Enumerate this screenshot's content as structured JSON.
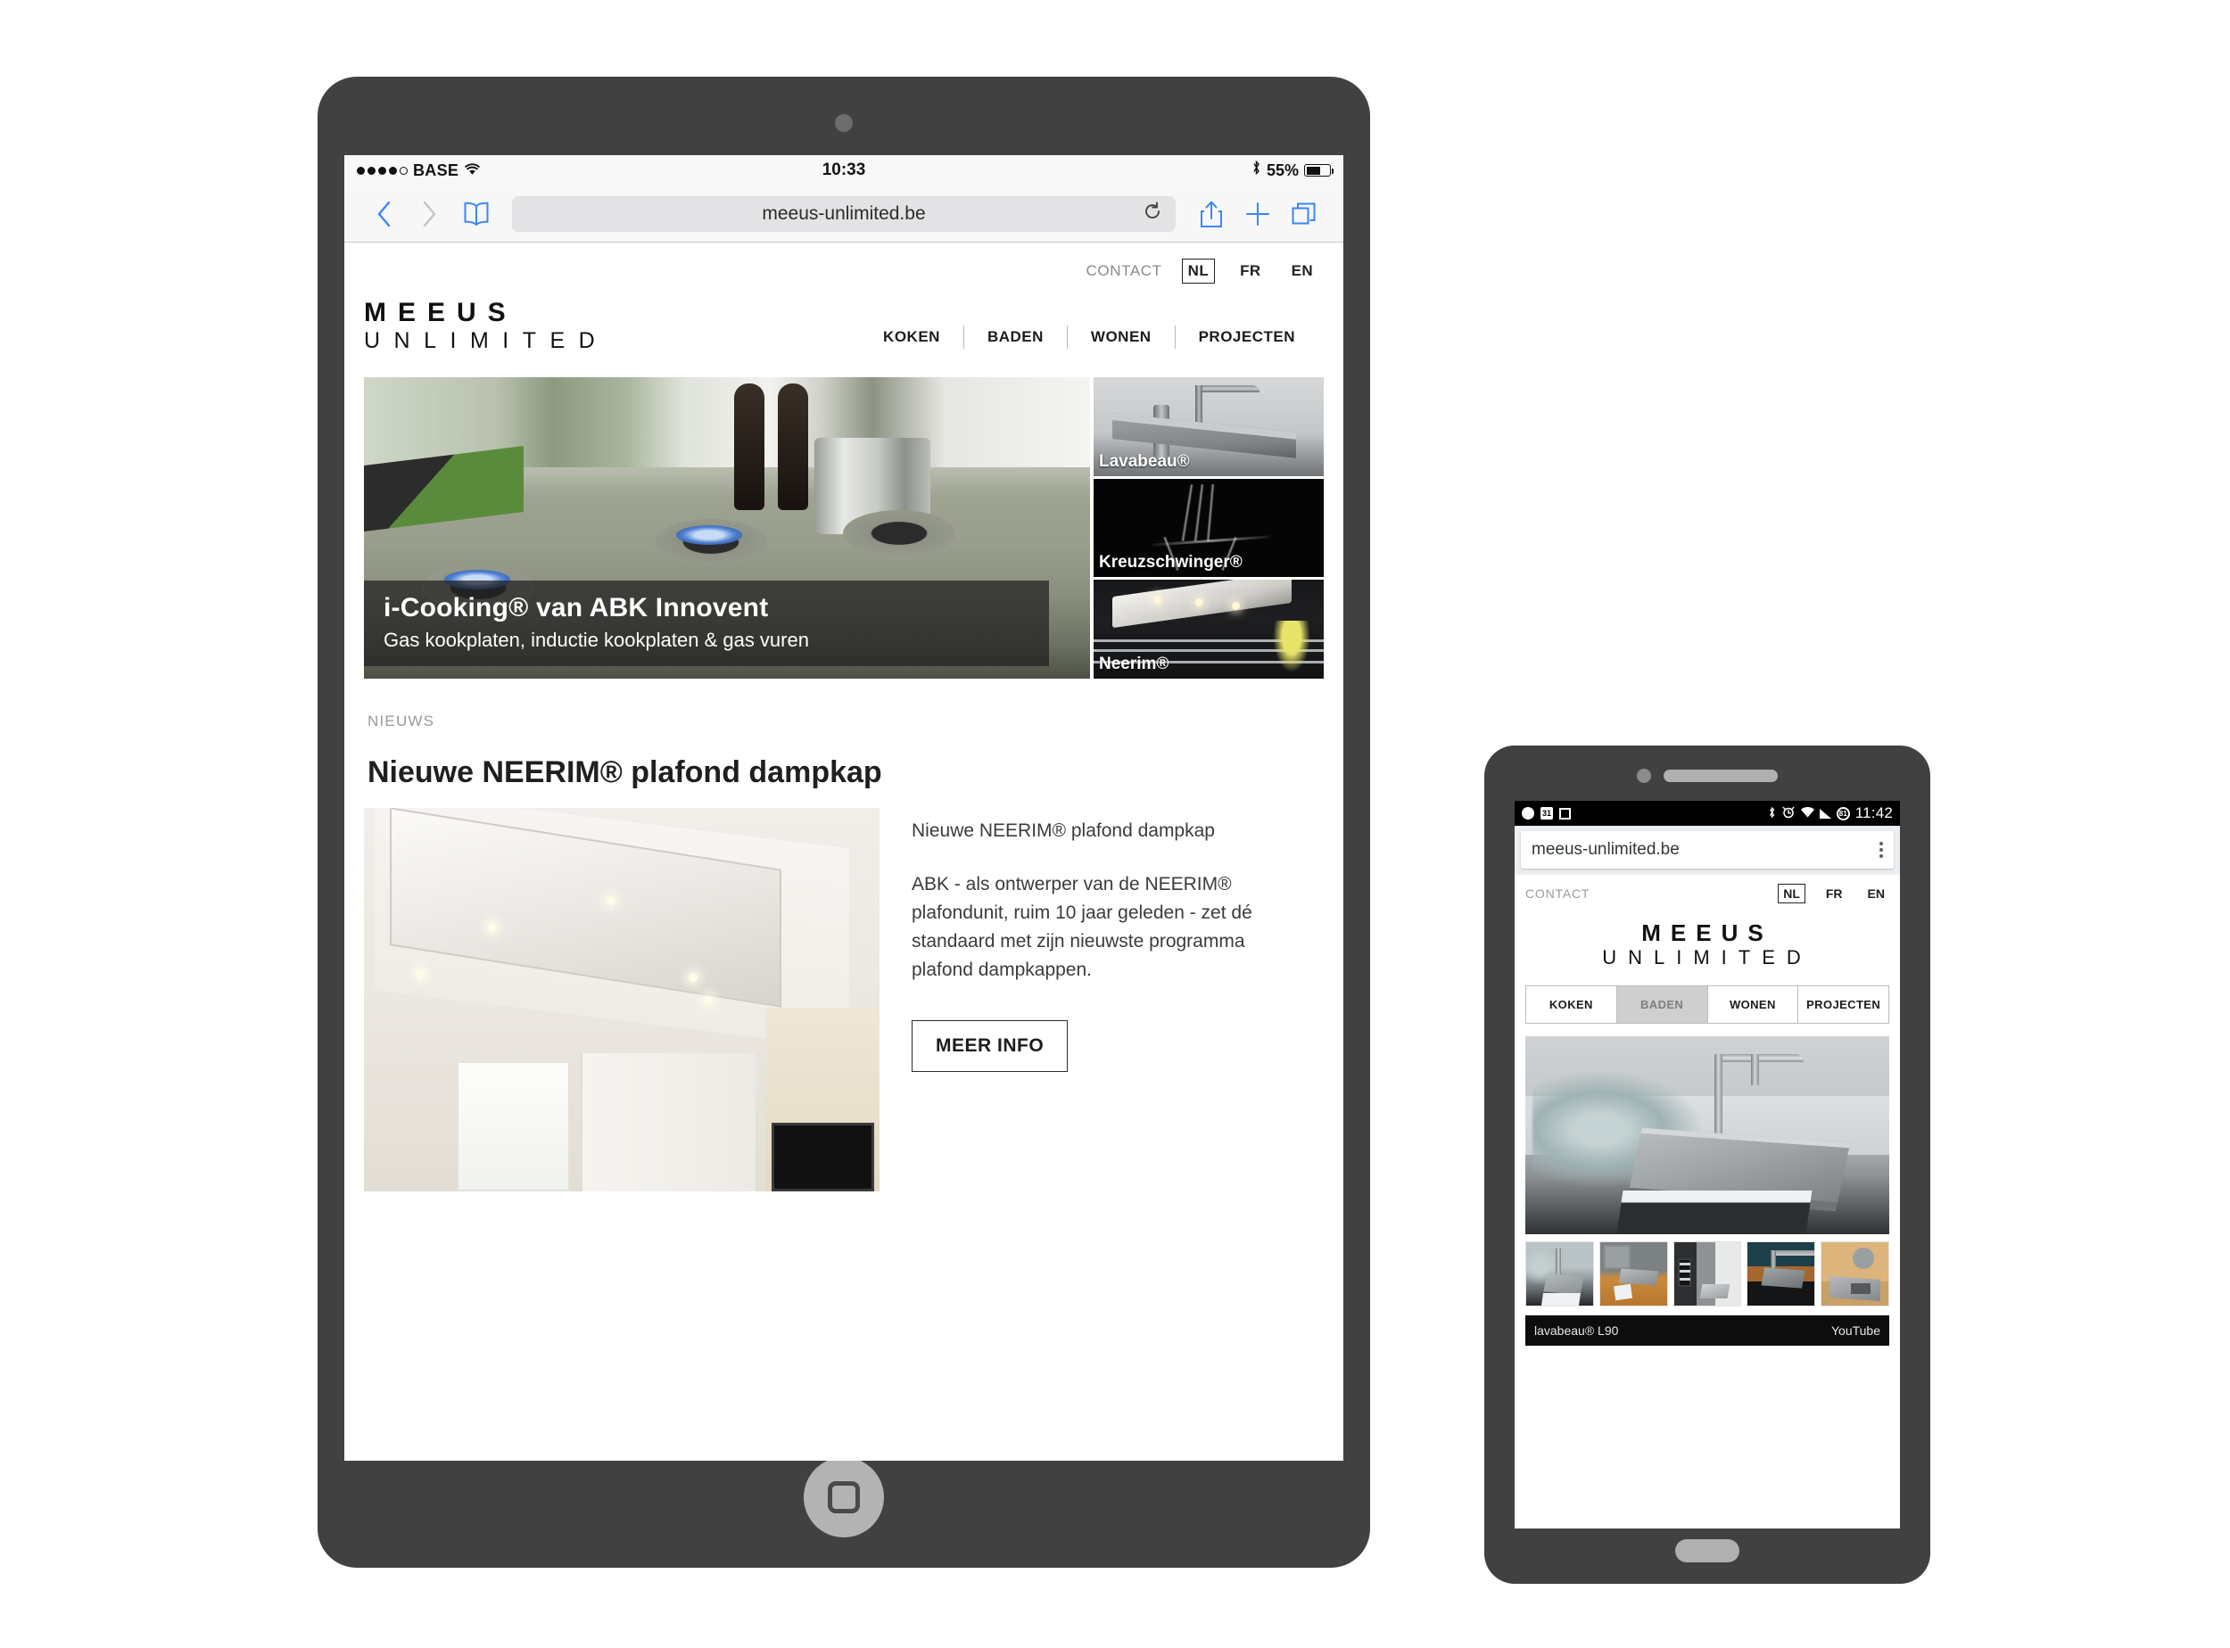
{
  "tablet": {
    "status_bar": {
      "carrier": "BASE",
      "wifi_icon": "wifi-icon",
      "time": "10:33",
      "bluetooth_icon": "bluetooth-icon",
      "battery_percent": "55%",
      "battery_icon": "battery-icon"
    },
    "browser": {
      "back_icon": "back-chevron-icon",
      "forward_icon": "forward-chevron-icon",
      "bookmarks_icon": "book-icon",
      "url": "meeus-unlimited.be",
      "reload_icon": "reload-icon",
      "share_icon": "share-icon",
      "new_tab_icon": "plus-icon",
      "tabs_icon": "tabs-icon"
    },
    "site": {
      "contact_label": "CONTACT",
      "languages": [
        {
          "code": "NL",
          "active": true
        },
        {
          "code": "FR",
          "active": false
        },
        {
          "code": "EN",
          "active": false
        }
      ],
      "logo_line1": "MEEUS",
      "logo_line2": "UNLIMITED",
      "nav": [
        "KOKEN",
        "BADEN",
        "WONEN",
        "PROJECTEN"
      ],
      "hero": {
        "title": "i-Cooking® van ABK Innovent",
        "subtitle": "Gas kookplaten, inductie kookplaten & gas vuren",
        "tiles": [
          {
            "label": "Lavabeau®",
            "image": "lavabeau-washbasin-photo"
          },
          {
            "label": "Kreuzschwinger®",
            "image": "kreuzschwinger-chair-photo"
          },
          {
            "label": "Neerim®",
            "image": "neerim-kitchen-photo"
          }
        ]
      },
      "news": {
        "kicker": "NIEUWS",
        "title": "Nieuwe NEERIM® plafond dampkap",
        "image": "neerim-ceiling-hood-photo",
        "lead": "Nieuwe NEERIM® plafond dampkap",
        "body": "ABK - als ontwerper van de NEERIM® plafondunit, ruim 10 jaar geleden - zet dé standaard met zijn nieuwste programma plafond dampkappen.",
        "button_label": "MEER INFO"
      }
    }
  },
  "phone": {
    "status_bar": {
      "spotify_icon": "spotify-icon",
      "calendar_icon": "calendar-icon",
      "calendar_day": "31",
      "square_icon": "square-icon",
      "bluetooth_icon": "bluetooth-icon",
      "alarm_icon": "alarm-icon",
      "wifi_icon": "wifi-icon",
      "signal_icon": "signal-bars-icon",
      "battery_icon": "battery-circle-icon",
      "battery_percent": "81",
      "time": "11:42"
    },
    "browser": {
      "url": "meeus-unlimited.be",
      "menu_icon": "kebab-menu-icon"
    },
    "site": {
      "contact_label": "CONTACT",
      "languages": [
        {
          "code": "NL",
          "active": true
        },
        {
          "code": "FR",
          "active": false
        },
        {
          "code": "EN",
          "active": false
        }
      ],
      "logo_line1": "MEEUS",
      "logo_line2": "UNLIMITED",
      "nav": [
        {
          "label": "KOKEN",
          "active": false
        },
        {
          "label": "BADEN",
          "active": true
        },
        {
          "label": "WONEN",
          "active": false
        },
        {
          "label": "PROJECTEN",
          "active": false
        }
      ],
      "hero_image": "lavabeau-outdoor-basin-photo",
      "thumbnails": [
        "lavabeau-grass-basin-thumb",
        "lavabeau-wood-counter-thumb",
        "bathroom-dark-shelf-thumb",
        "lavabeau-wood-basin-thumb",
        "shower-tray-wood-thumb"
      ],
      "video_bar": {
        "title": "lavabeau® L90",
        "source": "YouTube"
      }
    }
  },
  "colors": {
    "bezel": "#414141",
    "accent_blue": "#3a86f7",
    "page_bg": "#ffffff",
    "nav_active_bg": "#cfcfcf"
  }
}
